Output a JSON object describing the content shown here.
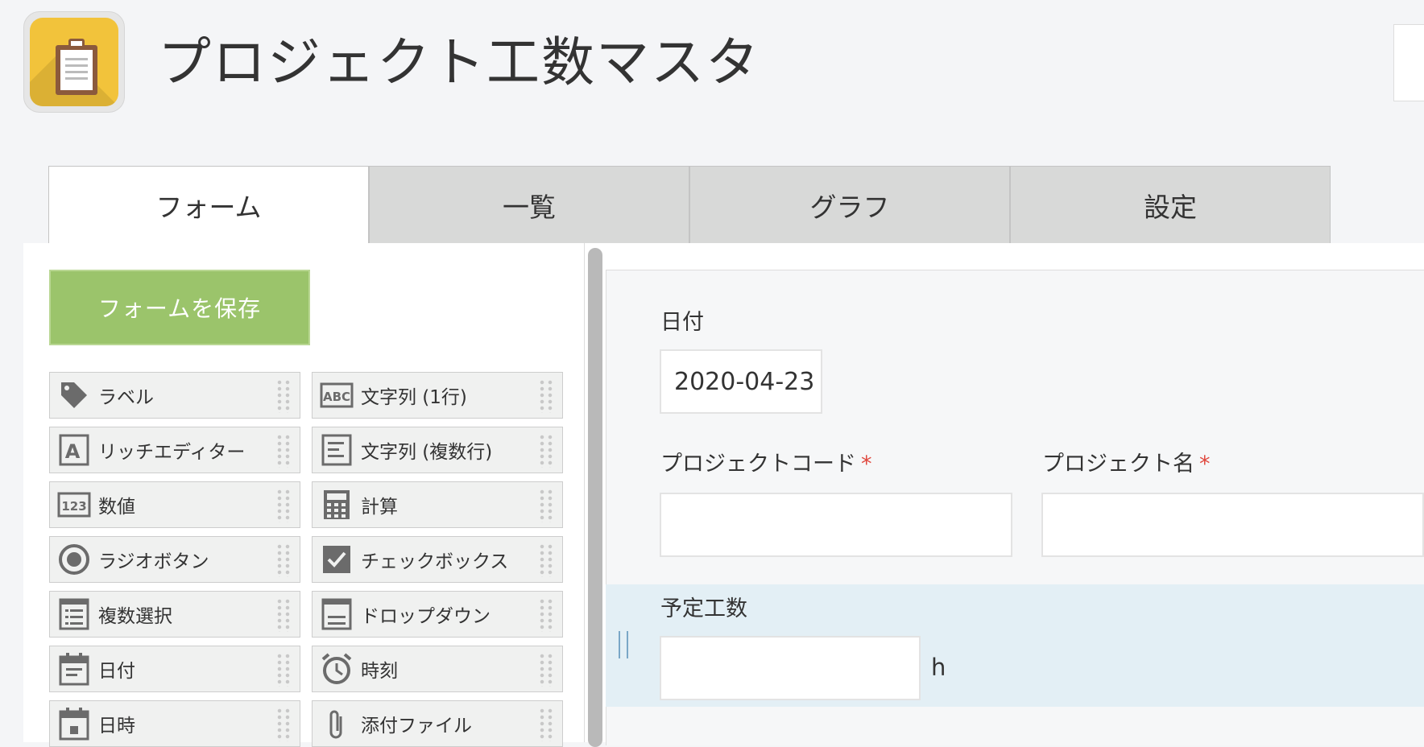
{
  "app": {
    "title": "プロジェクト工数マスタ",
    "icon": "clipboard-icon",
    "accent_color": "#f2c33b"
  },
  "tabs": [
    {
      "label": "フォーム",
      "active": true
    },
    {
      "label": "一覧",
      "active": false
    },
    {
      "label": "グラフ",
      "active": false
    },
    {
      "label": "設定",
      "active": false
    }
  ],
  "left_panel": {
    "save_label": "フォームを保存",
    "save_color": "#9bc46b",
    "palette": [
      {
        "label": "ラベル",
        "icon": "tag-icon"
      },
      {
        "label": "文字列 (1行)",
        "icon": "abc-text-icon"
      },
      {
        "label": "リッチエディター",
        "icon": "rich-editor-icon"
      },
      {
        "label": "文字列 (複数行)",
        "icon": "multiline-text-icon"
      },
      {
        "label": "数値",
        "icon": "number-123-icon"
      },
      {
        "label": "計算",
        "icon": "calculator-icon"
      },
      {
        "label": "ラジオボタン",
        "icon": "radio-button-icon"
      },
      {
        "label": "チェックボックス",
        "icon": "checkbox-icon"
      },
      {
        "label": "複数選択",
        "icon": "multi-select-icon"
      },
      {
        "label": "ドロップダウン",
        "icon": "dropdown-icon"
      },
      {
        "label": "日付",
        "icon": "calendar-icon"
      },
      {
        "label": "時刻",
        "icon": "alarm-clock-icon"
      },
      {
        "label": "日時",
        "icon": "datetime-icon"
      },
      {
        "label": "添付ファイル",
        "icon": "paperclip-icon"
      }
    ]
  },
  "form": {
    "date_label": "日付",
    "date_value": "2020-04-23",
    "project_code_label": "プロジェクトコード",
    "project_name_label": "プロジェクト名",
    "required_mark": "*",
    "planned_hours_label": "予定工数",
    "planned_hours_unit": "h"
  }
}
